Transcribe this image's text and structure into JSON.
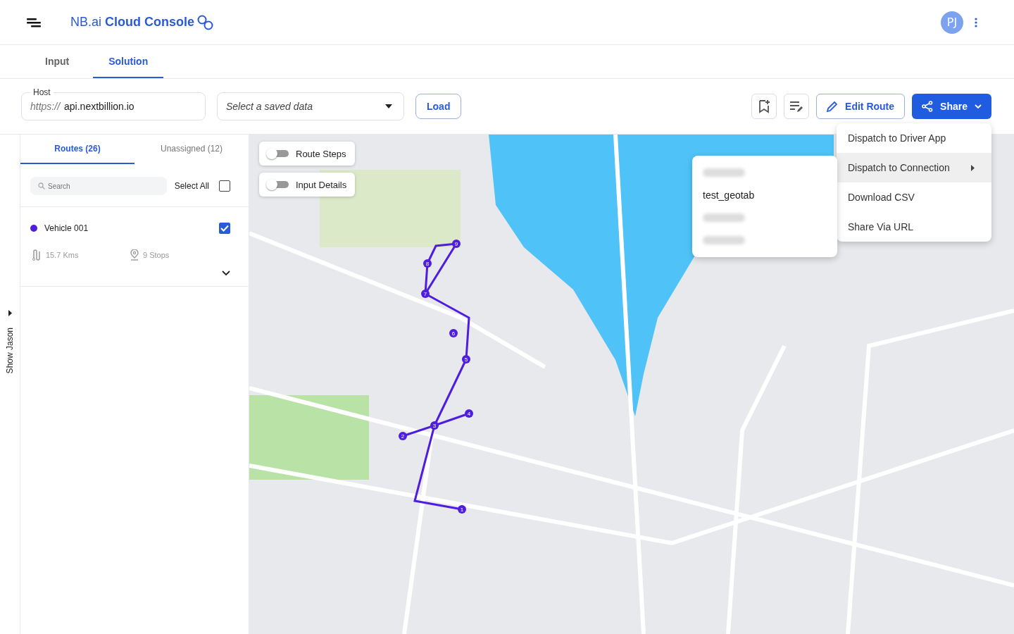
{
  "header": {
    "brand_light": "NB.ai",
    "brand_bold": "Cloud Console",
    "avatar": "PJ"
  },
  "tabs": [
    {
      "label": "Input",
      "selected": false
    },
    {
      "label": "Solution",
      "selected": true
    }
  ],
  "toolbar": {
    "host_label": "Host",
    "host_prefix": "https://",
    "host_value": "api.nextbillion.io",
    "saved_placeholder": "Select a saved data",
    "load": "Load",
    "edit_route": "Edit Route",
    "share": "Share"
  },
  "share_menu": [
    {
      "label": "Dispatch to Driver App",
      "selected": false,
      "submenu": false
    },
    {
      "label": "Dispatch to Connection",
      "selected": true,
      "submenu": true
    },
    {
      "label": "Download CSV",
      "selected": false,
      "submenu": false
    },
    {
      "label": "Share Via URL",
      "selected": false,
      "submenu": false
    }
  ],
  "connection_menu": [
    {
      "redacted": true
    },
    {
      "label": "test_geotab",
      "redacted": false
    },
    {
      "redacted": true
    },
    {
      "redacted": true
    }
  ],
  "side_toggle": "Show Jason",
  "panel_tabs": [
    {
      "label": "Routes (26)",
      "selected": true
    },
    {
      "label": "Unassigned (12)",
      "selected": false
    }
  ],
  "search_placeholder": "Search",
  "select_all": {
    "label": "Select All",
    "checked": false
  },
  "routes": [
    {
      "name": "Vehicle 001",
      "color": "#4f1de0",
      "checked": true,
      "distance": "15.7 Kms",
      "stops": "9 Stops"
    }
  ],
  "map_toggles": [
    {
      "label": "Route Steps",
      "on": false
    },
    {
      "label": "Input Details",
      "on": false
    }
  ],
  "route_stops": [
    "1",
    "2",
    "3",
    "4",
    "5",
    "6",
    "7",
    "8",
    "9"
  ]
}
